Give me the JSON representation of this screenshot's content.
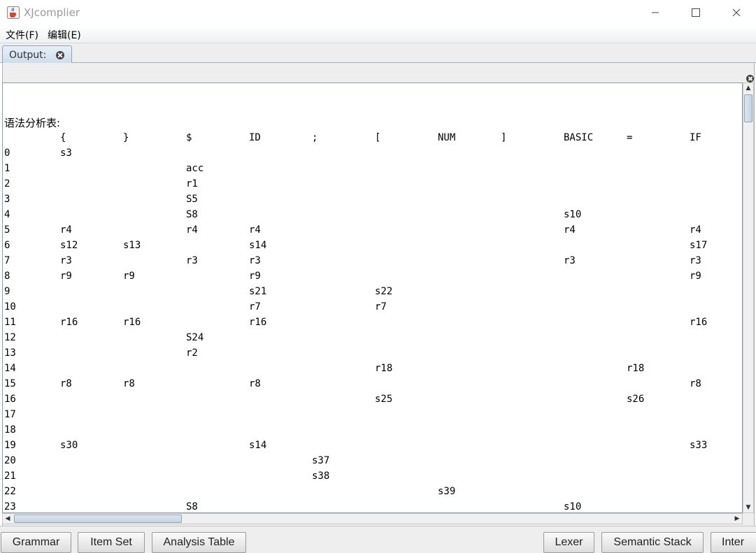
{
  "window": {
    "title": "XJcomplier",
    "controls": [
      "minimize-icon",
      "maximize-icon",
      "close-icon"
    ]
  },
  "menu": {
    "items": [
      {
        "label": "文件(F)"
      },
      {
        "label": "编辑(E)"
      }
    ]
  },
  "tabs": [
    {
      "label": "Output:"
    }
  ],
  "output": {
    "heading": "语法分析表:",
    "columns": [
      "{",
      "}",
      "$",
      "ID",
      ";",
      "[",
      "NUM",
      "]",
      "BASIC",
      "=",
      "IF"
    ],
    "rows": [
      {
        "state": "0",
        "cells": {
          "{": "s3"
        }
      },
      {
        "state": "1",
        "cells": {
          "$": "acc"
        }
      },
      {
        "state": "2",
        "cells": {
          "$": "r1"
        }
      },
      {
        "state": "3",
        "cells": {
          "$": "S5"
        }
      },
      {
        "state": "4",
        "cells": {
          "$": "S8",
          "BASIC": "s10"
        }
      },
      {
        "state": "5",
        "cells": {
          "{": "r4",
          "$": "r4",
          "ID": "r4",
          "BASIC": "r4",
          "IF": "r4"
        }
      },
      {
        "state": "6",
        "cells": {
          "{": "s12",
          "}": "s13",
          "ID": "s14",
          "IF": "s17"
        }
      },
      {
        "state": "7",
        "cells": {
          "{": "r3",
          "$": "r3",
          "ID": "r3",
          "BASIC": "r3",
          "IF": "r3"
        }
      },
      {
        "state": "8",
        "cells": {
          "{": "r9",
          "}": "r9",
          "ID": "r9",
          "IF": "r9"
        }
      },
      {
        "state": "9",
        "cells": {
          "ID": "s21",
          "[": "s22"
        }
      },
      {
        "state": "10",
        "cells": {
          "ID": "r7",
          "[": "r7"
        }
      },
      {
        "state": "11",
        "cells": {
          "{": "r16",
          "}": "r16",
          "ID": "r16",
          "IF": "r16"
        }
      },
      {
        "state": "12",
        "cells": {
          "$": "S24"
        }
      },
      {
        "state": "13",
        "cells": {
          "$": "r2"
        }
      },
      {
        "state": "14",
        "cells": {
          "[": "r18",
          "=": "r18"
        }
      },
      {
        "state": "15",
        "cells": {
          "{": "r8",
          "}": "r8",
          "ID": "r8",
          "IF": "r8"
        }
      },
      {
        "state": "16",
        "cells": {
          "[": "s25",
          "=": "s26"
        }
      },
      {
        "state": "17",
        "cells": {}
      },
      {
        "state": "18",
        "cells": {}
      },
      {
        "state": "19",
        "cells": {
          "{": "s30",
          "ID": "s14",
          "IF": "s33"
        }
      },
      {
        "state": "20",
        "cells": {
          ";": "s37"
        }
      },
      {
        "state": "21",
        "cells": {
          ";": "s38"
        }
      },
      {
        "state": "22",
        "cells": {
          "NUM": "s39"
        }
      },
      {
        "state": "23",
        "cells": {
          "$": "S8",
          "BASIC": "s10"
        }
      }
    ]
  },
  "buttons_left": [
    {
      "label": "Grammar",
      "name": "grammar-button"
    },
    {
      "label": "Item Set",
      "name": "item-set-button"
    },
    {
      "label": "Analysis Table",
      "name": "analysis-table-button"
    }
  ],
  "buttons_right": [
    {
      "label": "Lexer",
      "name": "lexer-button"
    },
    {
      "label": "Semantic Stack",
      "name": "semantic-stack-button"
    },
    {
      "label": "Inter",
      "name": "inter-button"
    }
  ],
  "colors": {
    "title_text": "#9a9a9a",
    "tab_background": "#cddcec",
    "panel_background": "#eeeeee"
  }
}
